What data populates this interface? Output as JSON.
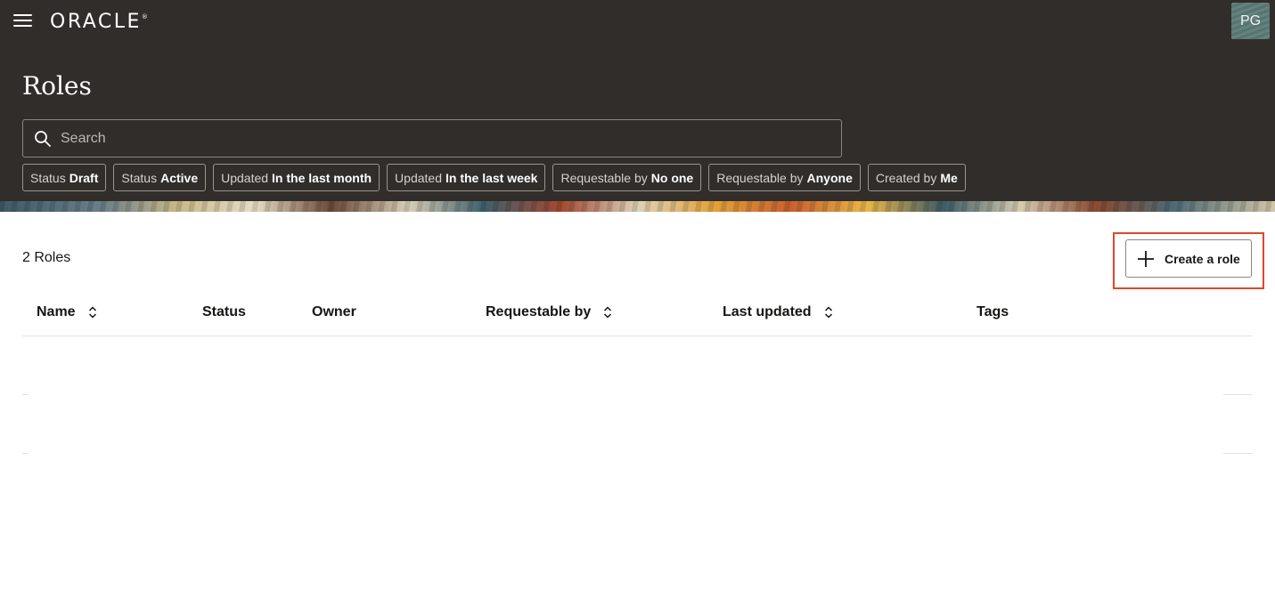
{
  "header": {
    "logo_text": "ORACLE",
    "logo_mark": "®",
    "avatar_initials": "PG",
    "page_title": "Roles"
  },
  "search": {
    "placeholder": "Search"
  },
  "filters": [
    {
      "key": "Status",
      "value": "Draft"
    },
    {
      "key": "Status",
      "value": "Active"
    },
    {
      "key": "Updated",
      "value": "In the last month"
    },
    {
      "key": "Updated",
      "value": "In the last week"
    },
    {
      "key": "Requestable by",
      "value": "No one"
    },
    {
      "key": "Requestable by",
      "value": "Anyone"
    },
    {
      "key": "Created by",
      "value": "Me"
    }
  ],
  "results": {
    "count_label": "2 Roles",
    "create_label": "Create a role"
  },
  "table": {
    "columns": [
      {
        "label": "Name",
        "sortable": true
      },
      {
        "label": "Status",
        "sortable": false
      },
      {
        "label": "Owner",
        "sortable": false
      },
      {
        "label": "Requestable by",
        "sortable": true
      },
      {
        "label": "Last updated",
        "sortable": true
      },
      {
        "label": "Tags",
        "sortable": false
      }
    ],
    "rows": []
  },
  "colors": {
    "header_bg": "#312d2a",
    "highlight": "#e0462c"
  }
}
